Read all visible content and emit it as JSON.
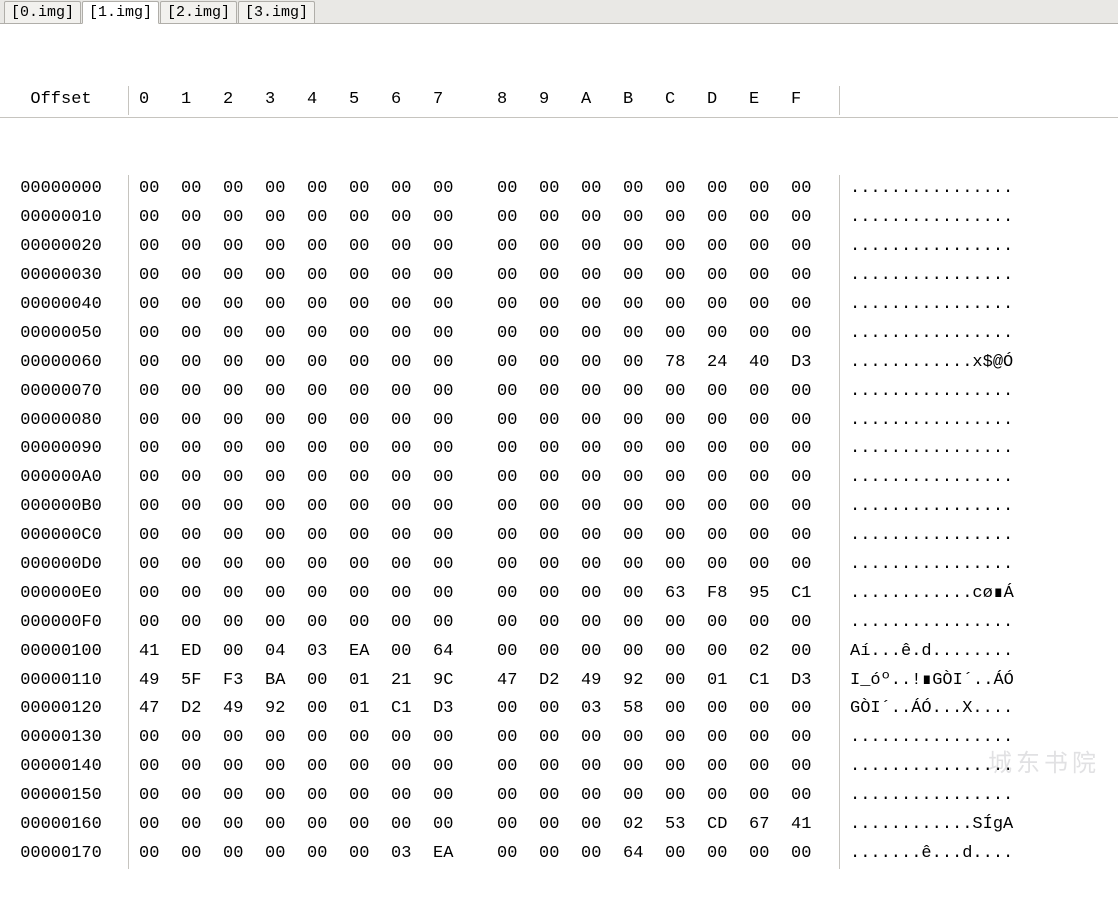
{
  "tabs": [
    {
      "label": "[0.img]",
      "active": false
    },
    {
      "label": "[1.img]",
      "active": true
    },
    {
      "label": "[2.img]",
      "active": false
    },
    {
      "label": "[3.img]",
      "active": false
    }
  ],
  "header": {
    "offset_label": "Offset",
    "columns": [
      "0",
      "1",
      "2",
      "3",
      "4",
      "5",
      "6",
      "7",
      "8",
      "9",
      "A",
      "B",
      "C",
      "D",
      "E",
      "F"
    ]
  },
  "rows": [
    {
      "offset": "00000000",
      "bytes": [
        "00",
        "00",
        "00",
        "00",
        "00",
        "00",
        "00",
        "00",
        "00",
        "00",
        "00",
        "00",
        "00",
        "00",
        "00",
        "00"
      ],
      "ascii": "................"
    },
    {
      "offset": "00000010",
      "bytes": [
        "00",
        "00",
        "00",
        "00",
        "00",
        "00",
        "00",
        "00",
        "00",
        "00",
        "00",
        "00",
        "00",
        "00",
        "00",
        "00"
      ],
      "ascii": "................"
    },
    {
      "offset": "00000020",
      "bytes": [
        "00",
        "00",
        "00",
        "00",
        "00",
        "00",
        "00",
        "00",
        "00",
        "00",
        "00",
        "00",
        "00",
        "00",
        "00",
        "00"
      ],
      "ascii": "................"
    },
    {
      "offset": "00000030",
      "bytes": [
        "00",
        "00",
        "00",
        "00",
        "00",
        "00",
        "00",
        "00",
        "00",
        "00",
        "00",
        "00",
        "00",
        "00",
        "00",
        "00"
      ],
      "ascii": "................"
    },
    {
      "offset": "00000040",
      "bytes": [
        "00",
        "00",
        "00",
        "00",
        "00",
        "00",
        "00",
        "00",
        "00",
        "00",
        "00",
        "00",
        "00",
        "00",
        "00",
        "00"
      ],
      "ascii": "................"
    },
    {
      "offset": "00000050",
      "bytes": [
        "00",
        "00",
        "00",
        "00",
        "00",
        "00",
        "00",
        "00",
        "00",
        "00",
        "00",
        "00",
        "00",
        "00",
        "00",
        "00"
      ],
      "ascii": "................"
    },
    {
      "offset": "00000060",
      "bytes": [
        "00",
        "00",
        "00",
        "00",
        "00",
        "00",
        "00",
        "00",
        "00",
        "00",
        "00",
        "00",
        "78",
        "24",
        "40",
        "D3"
      ],
      "ascii": "............x$@Ó"
    },
    {
      "offset": "00000070",
      "bytes": [
        "00",
        "00",
        "00",
        "00",
        "00",
        "00",
        "00",
        "00",
        "00",
        "00",
        "00",
        "00",
        "00",
        "00",
        "00",
        "00"
      ],
      "ascii": "................"
    },
    {
      "offset": "00000080",
      "bytes": [
        "00",
        "00",
        "00",
        "00",
        "00",
        "00",
        "00",
        "00",
        "00",
        "00",
        "00",
        "00",
        "00",
        "00",
        "00",
        "00"
      ],
      "ascii": "................"
    },
    {
      "offset": "00000090",
      "bytes": [
        "00",
        "00",
        "00",
        "00",
        "00",
        "00",
        "00",
        "00",
        "00",
        "00",
        "00",
        "00",
        "00",
        "00",
        "00",
        "00"
      ],
      "ascii": "................"
    },
    {
      "offset": "000000A0",
      "bytes": [
        "00",
        "00",
        "00",
        "00",
        "00",
        "00",
        "00",
        "00",
        "00",
        "00",
        "00",
        "00",
        "00",
        "00",
        "00",
        "00"
      ],
      "ascii": "................"
    },
    {
      "offset": "000000B0",
      "bytes": [
        "00",
        "00",
        "00",
        "00",
        "00",
        "00",
        "00",
        "00",
        "00",
        "00",
        "00",
        "00",
        "00",
        "00",
        "00",
        "00"
      ],
      "ascii": "................"
    },
    {
      "offset": "000000C0",
      "bytes": [
        "00",
        "00",
        "00",
        "00",
        "00",
        "00",
        "00",
        "00",
        "00",
        "00",
        "00",
        "00",
        "00",
        "00",
        "00",
        "00"
      ],
      "ascii": "................"
    },
    {
      "offset": "000000D0",
      "bytes": [
        "00",
        "00",
        "00",
        "00",
        "00",
        "00",
        "00",
        "00",
        "00",
        "00",
        "00",
        "00",
        "00",
        "00",
        "00",
        "00"
      ],
      "ascii": "................"
    },
    {
      "offset": "000000E0",
      "bytes": [
        "00",
        "00",
        "00",
        "00",
        "00",
        "00",
        "00",
        "00",
        "00",
        "00",
        "00",
        "00",
        "63",
        "F8",
        "95",
        "C1"
      ],
      "ascii": "............cø∎Á"
    },
    {
      "offset": "000000F0",
      "bytes": [
        "00",
        "00",
        "00",
        "00",
        "00",
        "00",
        "00",
        "00",
        "00",
        "00",
        "00",
        "00",
        "00",
        "00",
        "00",
        "00"
      ],
      "ascii": "................"
    },
    {
      "offset": "00000100",
      "bytes": [
        "41",
        "ED",
        "00",
        "04",
        "03",
        "EA",
        "00",
        "64",
        "00",
        "00",
        "00",
        "00",
        "00",
        "00",
        "02",
        "00"
      ],
      "ascii": "Aí...ê.d........"
    },
    {
      "offset": "00000110",
      "bytes": [
        "49",
        "5F",
        "F3",
        "BA",
        "00",
        "01",
        "21",
        "9C",
        "47",
        "D2",
        "49",
        "92",
        "00",
        "01",
        "C1",
        "D3"
      ],
      "ascii": "I_óº..!∎GÒI´..ÁÓ"
    },
    {
      "offset": "00000120",
      "bytes": [
        "47",
        "D2",
        "49",
        "92",
        "00",
        "01",
        "C1",
        "D3",
        "00",
        "00",
        "03",
        "58",
        "00",
        "00",
        "00",
        "00"
      ],
      "ascii": "GÒI´..ÁÓ...X...."
    },
    {
      "offset": "00000130",
      "bytes": [
        "00",
        "00",
        "00",
        "00",
        "00",
        "00",
        "00",
        "00",
        "00",
        "00",
        "00",
        "00",
        "00",
        "00",
        "00",
        "00"
      ],
      "ascii": "................"
    },
    {
      "offset": "00000140",
      "bytes": [
        "00",
        "00",
        "00",
        "00",
        "00",
        "00",
        "00",
        "00",
        "00",
        "00",
        "00",
        "00",
        "00",
        "00",
        "00",
        "00"
      ],
      "ascii": "................"
    },
    {
      "offset": "00000150",
      "bytes": [
        "00",
        "00",
        "00",
        "00",
        "00",
        "00",
        "00",
        "00",
        "00",
        "00",
        "00",
        "00",
        "00",
        "00",
        "00",
        "00"
      ],
      "ascii": "................"
    },
    {
      "offset": "00000160",
      "bytes": [
        "00",
        "00",
        "00",
        "00",
        "00",
        "00",
        "00",
        "00",
        "00",
        "00",
        "00",
        "02",
        "53",
        "CD",
        "67",
        "41"
      ],
      "ascii": "............SÍgA"
    },
    {
      "offset": "00000170",
      "bytes": [
        "00",
        "00",
        "00",
        "00",
        "00",
        "00",
        "03",
        "EA",
        "00",
        "00",
        "00",
        "64",
        "00",
        "00",
        "00",
        "00"
      ],
      "ascii": ".......ê...d...."
    }
  ],
  "watermark": "城东书院"
}
